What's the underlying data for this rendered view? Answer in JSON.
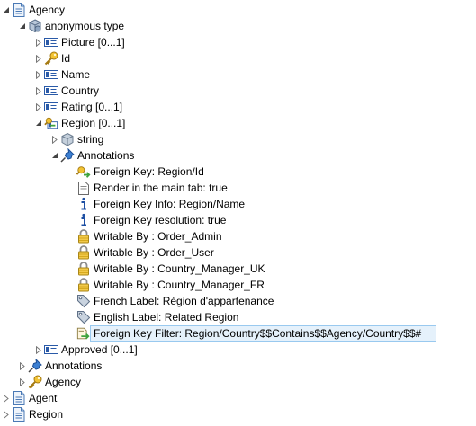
{
  "tree": [
    {
      "label": "Agency",
      "icon": "document-icon",
      "expander": "expanded"
    },
    {
      "label": "anonymous type",
      "icon": "complex-type-icon",
      "expander": "expanded"
    },
    {
      "label": "Picture  [0...1]",
      "icon": "field-icon",
      "expander": "collapsed"
    },
    {
      "label": "Id",
      "icon": "key-icon",
      "expander": "collapsed"
    },
    {
      "label": "Name",
      "icon": "field-icon",
      "expander": "collapsed"
    },
    {
      "label": "Country",
      "icon": "field-icon",
      "expander": "collapsed"
    },
    {
      "label": "Rating  [0...1]",
      "icon": "field-icon",
      "expander": "collapsed"
    },
    {
      "label": "Region  [0...1]",
      "icon": "foreign-key-field-icon",
      "expander": "expanded"
    },
    {
      "label": "string",
      "icon": "simple-type-icon",
      "expander": "collapsed"
    },
    {
      "label": "Annotations",
      "icon": "pin-icon",
      "expander": "expanded"
    },
    {
      "label": "Foreign Key:  Region/Id",
      "icon": "foreign-key-icon",
      "expander": "none"
    },
    {
      "label": "Render in the main tab: true",
      "icon": "page-icon",
      "expander": "none"
    },
    {
      "label": "Foreign Key Info:  Region/Name",
      "icon": "info-icon",
      "expander": "none"
    },
    {
      "label": "Foreign Key resolution:  true",
      "icon": "info-icon",
      "expander": "none"
    },
    {
      "label": "Writable By : Order_Admin",
      "icon": "lock-icon",
      "expander": "none"
    },
    {
      "label": "Writable By : Order_User",
      "icon": "lock-icon",
      "expander": "none"
    },
    {
      "label": "Writable By : Country_Manager_UK",
      "icon": "lock-icon",
      "expander": "none"
    },
    {
      "label": "Writable By : Country_Manager_FR",
      "icon": "lock-icon",
      "expander": "none"
    },
    {
      "label": "French Label: Région d'appartenance",
      "icon": "tag-icon",
      "expander": "none"
    },
    {
      "label": "English Label: Related Region",
      "icon": "tag-icon",
      "expander": "none"
    },
    {
      "label": "Foreign Key Filter:  Region/Country$$Contains$$Agency/Country$$#",
      "icon": "filter-icon",
      "expander": "none",
      "selected": true
    },
    {
      "label": "Approved  [0...1]",
      "icon": "field-icon",
      "expander": "collapsed"
    },
    {
      "label": "Annotations",
      "icon": "pin-icon",
      "expander": "collapsed"
    },
    {
      "label": "Agency",
      "icon": "key-icon",
      "expander": "collapsed"
    },
    {
      "label": "Agent",
      "icon": "document-icon",
      "expander": "collapsed"
    },
    {
      "label": "Region",
      "icon": "document-icon",
      "expander": "collapsed"
    }
  ]
}
